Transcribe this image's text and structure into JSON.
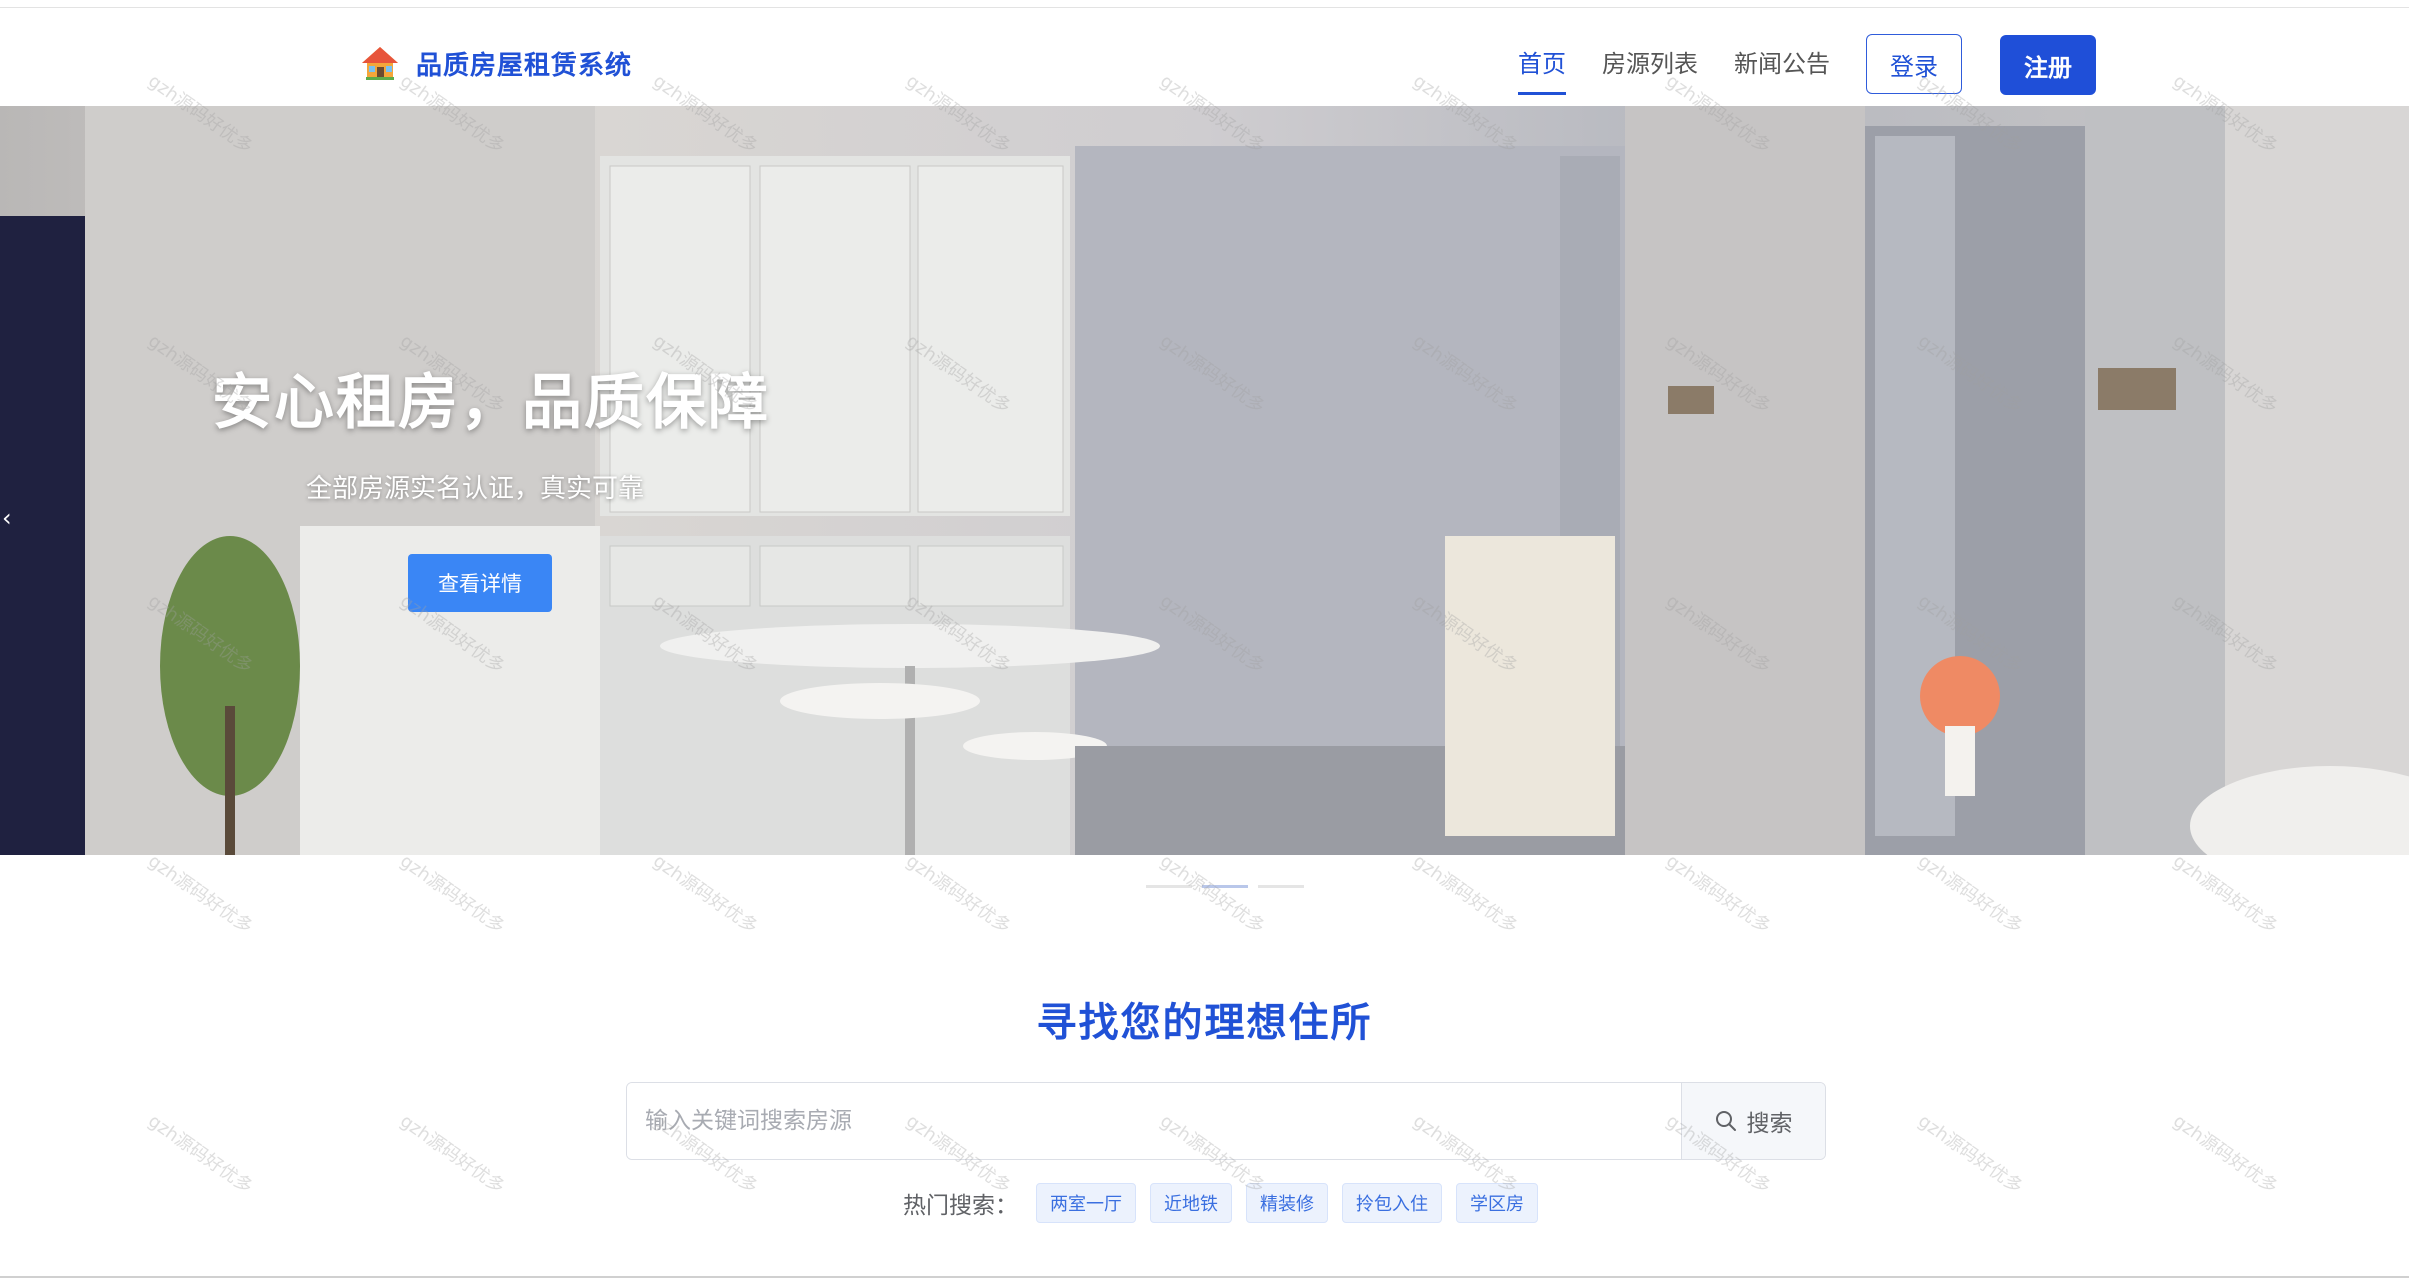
{
  "header": {
    "brand_title": "品质房屋租赁系统",
    "brand_icon": "house-icon",
    "nav": [
      {
        "label": "首页",
        "active": true
      },
      {
        "label": "房源列表",
        "active": false
      },
      {
        "label": "新闻公告",
        "active": false
      }
    ],
    "login_label": "登录",
    "register_label": "注册"
  },
  "banner": {
    "title": "安心租房，品质保障",
    "subtitle": "全部房源实名认证，真实可靠",
    "button_label": "查看详情",
    "prev_icon": "chevron-left-icon",
    "slide_count": 3,
    "active_slide": 1
  },
  "search": {
    "heading": "寻找您的理想住所",
    "placeholder": "输入关键词搜索房源",
    "value": "",
    "button_label": "搜索",
    "button_icon": "search-icon",
    "hot_label": "热门搜索：",
    "hot_tags": [
      "两室一厅",
      "近地铁",
      "精装修",
      "拎包入住",
      "学区房"
    ]
  },
  "watermark": "gzh源码好优多",
  "colors": {
    "primary": "#1f4fd8",
    "hero_button": "#3a86f5",
    "tag_bg": "#ecf2fd"
  }
}
